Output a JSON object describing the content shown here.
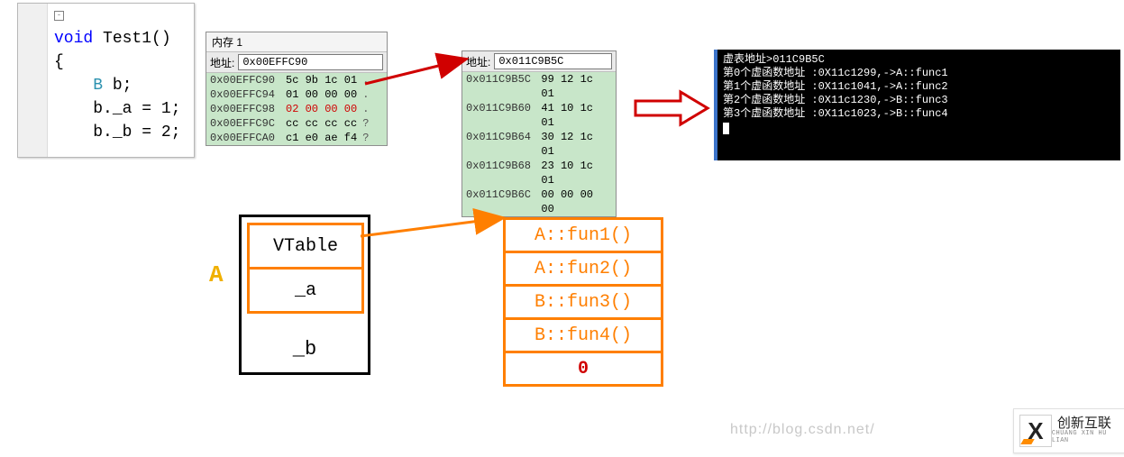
{
  "code": {
    "line1_void": "void",
    "line1_rest": " Test1()",
    "line2": "{",
    "line3_type": "B",
    "line3_rest": " b;",
    "line4": "b._a = 1;",
    "line5": "b._b = 2;"
  },
  "memory1": {
    "tab": "内存 1",
    "addr_label": "地址:",
    "addr_value": "0x00EFFC90",
    "rows": [
      {
        "addr": "0x00EFFC90",
        "bytes": "5c 9b 1c 01",
        "suffix": "."
      },
      {
        "addr": "0x00EFFC94",
        "bytes": "01 00 00 00",
        "suffix": "."
      },
      {
        "addr": "0x00EFFC98",
        "bytes": "02 00 00 00",
        "suffix": ".",
        "red": true
      },
      {
        "addr": "0x00EFFC9C",
        "bytes": "cc cc cc cc",
        "suffix": "?"
      },
      {
        "addr": "0x00EFFCA0",
        "bytes": "c1 e0 ae f4",
        "suffix": "?"
      }
    ]
  },
  "memory2": {
    "addr_label": "地址:",
    "addr_value": "0x011C9B5C",
    "rows": [
      {
        "addr": "0x011C9B5C",
        "bytes": "99 12 1c 01"
      },
      {
        "addr": "0x011C9B60",
        "bytes": "41 10 1c 01"
      },
      {
        "addr": "0x011C9B64",
        "bytes": "30 12 1c 01"
      },
      {
        "addr": "0x011C9B68",
        "bytes": "23 10 1c 01"
      },
      {
        "addr": "0x011C9B6C",
        "bytes": "00 00 00 00"
      }
    ]
  },
  "console": {
    "l0": "虚表地址>011C9B5C",
    "l1": "第0个虚函数地址 :0X11c1299,->A::func1",
    "l2": "第1个虚函数地址 :0X11c1041,->A::func2",
    "l3": "第2个虚函数地址 :0X11c1230,->B::func3",
    "l4": "第3个虚函数地址 :0X11c1023,->B::func4"
  },
  "diagram": {
    "a_label": "A",
    "cells": [
      "VTable",
      "_a"
    ],
    "b_cell": "_b",
    "vtable": [
      "A::fun1()",
      "A::fun2()",
      "B::fun3()",
      "B::fun4()",
      "0"
    ]
  },
  "watermark": "http://blog.csdn.net/",
  "logo_cn": "创新互联",
  "logo_en": "CHUANG XIN HU LIAN"
}
